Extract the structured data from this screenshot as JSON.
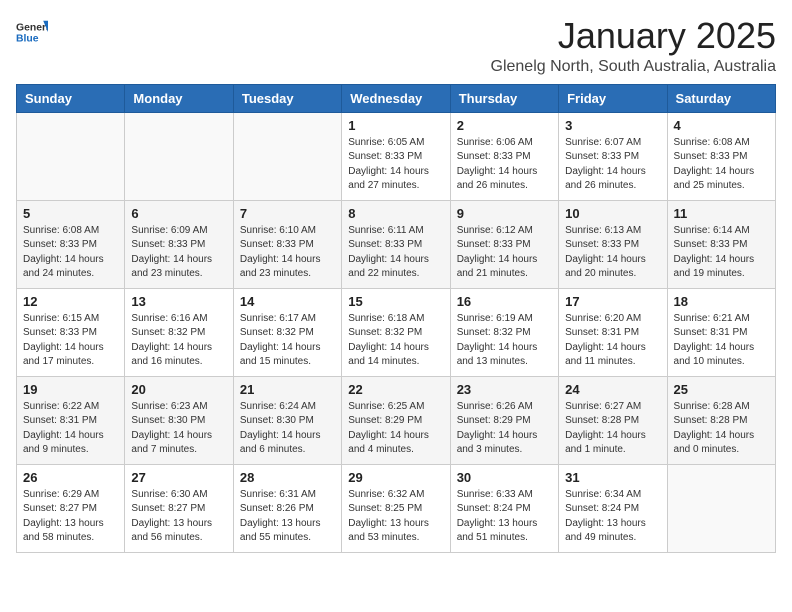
{
  "logo": {
    "general": "General",
    "blue": "Blue"
  },
  "header": {
    "month": "January 2025",
    "location": "Glenelg North, South Australia, Australia"
  },
  "weekdays": [
    "Sunday",
    "Monday",
    "Tuesday",
    "Wednesday",
    "Thursday",
    "Friday",
    "Saturday"
  ],
  "weeks": [
    {
      "shaded": false,
      "days": [
        {
          "date": "",
          "sunrise": "",
          "sunset": "",
          "daylight": ""
        },
        {
          "date": "",
          "sunrise": "",
          "sunset": "",
          "daylight": ""
        },
        {
          "date": "",
          "sunrise": "",
          "sunset": "",
          "daylight": ""
        },
        {
          "date": "1",
          "sunrise": "Sunrise: 6:05 AM",
          "sunset": "Sunset: 8:33 PM",
          "daylight": "Daylight: 14 hours and 27 minutes."
        },
        {
          "date": "2",
          "sunrise": "Sunrise: 6:06 AM",
          "sunset": "Sunset: 8:33 PM",
          "daylight": "Daylight: 14 hours and 26 minutes."
        },
        {
          "date": "3",
          "sunrise": "Sunrise: 6:07 AM",
          "sunset": "Sunset: 8:33 PM",
          "daylight": "Daylight: 14 hours and 26 minutes."
        },
        {
          "date": "4",
          "sunrise": "Sunrise: 6:08 AM",
          "sunset": "Sunset: 8:33 PM",
          "daylight": "Daylight: 14 hours and 25 minutes."
        }
      ]
    },
    {
      "shaded": true,
      "days": [
        {
          "date": "5",
          "sunrise": "Sunrise: 6:08 AM",
          "sunset": "Sunset: 8:33 PM",
          "daylight": "Daylight: 14 hours and 24 minutes."
        },
        {
          "date": "6",
          "sunrise": "Sunrise: 6:09 AM",
          "sunset": "Sunset: 8:33 PM",
          "daylight": "Daylight: 14 hours and 23 minutes."
        },
        {
          "date": "7",
          "sunrise": "Sunrise: 6:10 AM",
          "sunset": "Sunset: 8:33 PM",
          "daylight": "Daylight: 14 hours and 23 minutes."
        },
        {
          "date": "8",
          "sunrise": "Sunrise: 6:11 AM",
          "sunset": "Sunset: 8:33 PM",
          "daylight": "Daylight: 14 hours and 22 minutes."
        },
        {
          "date": "9",
          "sunrise": "Sunrise: 6:12 AM",
          "sunset": "Sunset: 8:33 PM",
          "daylight": "Daylight: 14 hours and 21 minutes."
        },
        {
          "date": "10",
          "sunrise": "Sunrise: 6:13 AM",
          "sunset": "Sunset: 8:33 PM",
          "daylight": "Daylight: 14 hours and 20 minutes."
        },
        {
          "date": "11",
          "sunrise": "Sunrise: 6:14 AM",
          "sunset": "Sunset: 8:33 PM",
          "daylight": "Daylight: 14 hours and 19 minutes."
        }
      ]
    },
    {
      "shaded": false,
      "days": [
        {
          "date": "12",
          "sunrise": "Sunrise: 6:15 AM",
          "sunset": "Sunset: 8:33 PM",
          "daylight": "Daylight: 14 hours and 17 minutes."
        },
        {
          "date": "13",
          "sunrise": "Sunrise: 6:16 AM",
          "sunset": "Sunset: 8:32 PM",
          "daylight": "Daylight: 14 hours and 16 minutes."
        },
        {
          "date": "14",
          "sunrise": "Sunrise: 6:17 AM",
          "sunset": "Sunset: 8:32 PM",
          "daylight": "Daylight: 14 hours and 15 minutes."
        },
        {
          "date": "15",
          "sunrise": "Sunrise: 6:18 AM",
          "sunset": "Sunset: 8:32 PM",
          "daylight": "Daylight: 14 hours and 14 minutes."
        },
        {
          "date": "16",
          "sunrise": "Sunrise: 6:19 AM",
          "sunset": "Sunset: 8:32 PM",
          "daylight": "Daylight: 14 hours and 13 minutes."
        },
        {
          "date": "17",
          "sunrise": "Sunrise: 6:20 AM",
          "sunset": "Sunset: 8:31 PM",
          "daylight": "Daylight: 14 hours and 11 minutes."
        },
        {
          "date": "18",
          "sunrise": "Sunrise: 6:21 AM",
          "sunset": "Sunset: 8:31 PM",
          "daylight": "Daylight: 14 hours and 10 minutes."
        }
      ]
    },
    {
      "shaded": true,
      "days": [
        {
          "date": "19",
          "sunrise": "Sunrise: 6:22 AM",
          "sunset": "Sunset: 8:31 PM",
          "daylight": "Daylight: 14 hours and 9 minutes."
        },
        {
          "date": "20",
          "sunrise": "Sunrise: 6:23 AM",
          "sunset": "Sunset: 8:30 PM",
          "daylight": "Daylight: 14 hours and 7 minutes."
        },
        {
          "date": "21",
          "sunrise": "Sunrise: 6:24 AM",
          "sunset": "Sunset: 8:30 PM",
          "daylight": "Daylight: 14 hours and 6 minutes."
        },
        {
          "date": "22",
          "sunrise": "Sunrise: 6:25 AM",
          "sunset": "Sunset: 8:29 PM",
          "daylight": "Daylight: 14 hours and 4 minutes."
        },
        {
          "date": "23",
          "sunrise": "Sunrise: 6:26 AM",
          "sunset": "Sunset: 8:29 PM",
          "daylight": "Daylight: 14 hours and 3 minutes."
        },
        {
          "date": "24",
          "sunrise": "Sunrise: 6:27 AM",
          "sunset": "Sunset: 8:28 PM",
          "daylight": "Daylight: 14 hours and 1 minute."
        },
        {
          "date": "25",
          "sunrise": "Sunrise: 6:28 AM",
          "sunset": "Sunset: 8:28 PM",
          "daylight": "Daylight: 14 hours and 0 minutes."
        }
      ]
    },
    {
      "shaded": false,
      "days": [
        {
          "date": "26",
          "sunrise": "Sunrise: 6:29 AM",
          "sunset": "Sunset: 8:27 PM",
          "daylight": "Daylight: 13 hours and 58 minutes."
        },
        {
          "date": "27",
          "sunrise": "Sunrise: 6:30 AM",
          "sunset": "Sunset: 8:27 PM",
          "daylight": "Daylight: 13 hours and 56 minutes."
        },
        {
          "date": "28",
          "sunrise": "Sunrise: 6:31 AM",
          "sunset": "Sunset: 8:26 PM",
          "daylight": "Daylight: 13 hours and 55 minutes."
        },
        {
          "date": "29",
          "sunrise": "Sunrise: 6:32 AM",
          "sunset": "Sunset: 8:25 PM",
          "daylight": "Daylight: 13 hours and 53 minutes."
        },
        {
          "date": "30",
          "sunrise": "Sunrise: 6:33 AM",
          "sunset": "Sunset: 8:24 PM",
          "daylight": "Daylight: 13 hours and 51 minutes."
        },
        {
          "date": "31",
          "sunrise": "Sunrise: 6:34 AM",
          "sunset": "Sunset: 8:24 PM",
          "daylight": "Daylight: 13 hours and 49 minutes."
        },
        {
          "date": "",
          "sunrise": "",
          "sunset": "",
          "daylight": ""
        }
      ]
    }
  ]
}
